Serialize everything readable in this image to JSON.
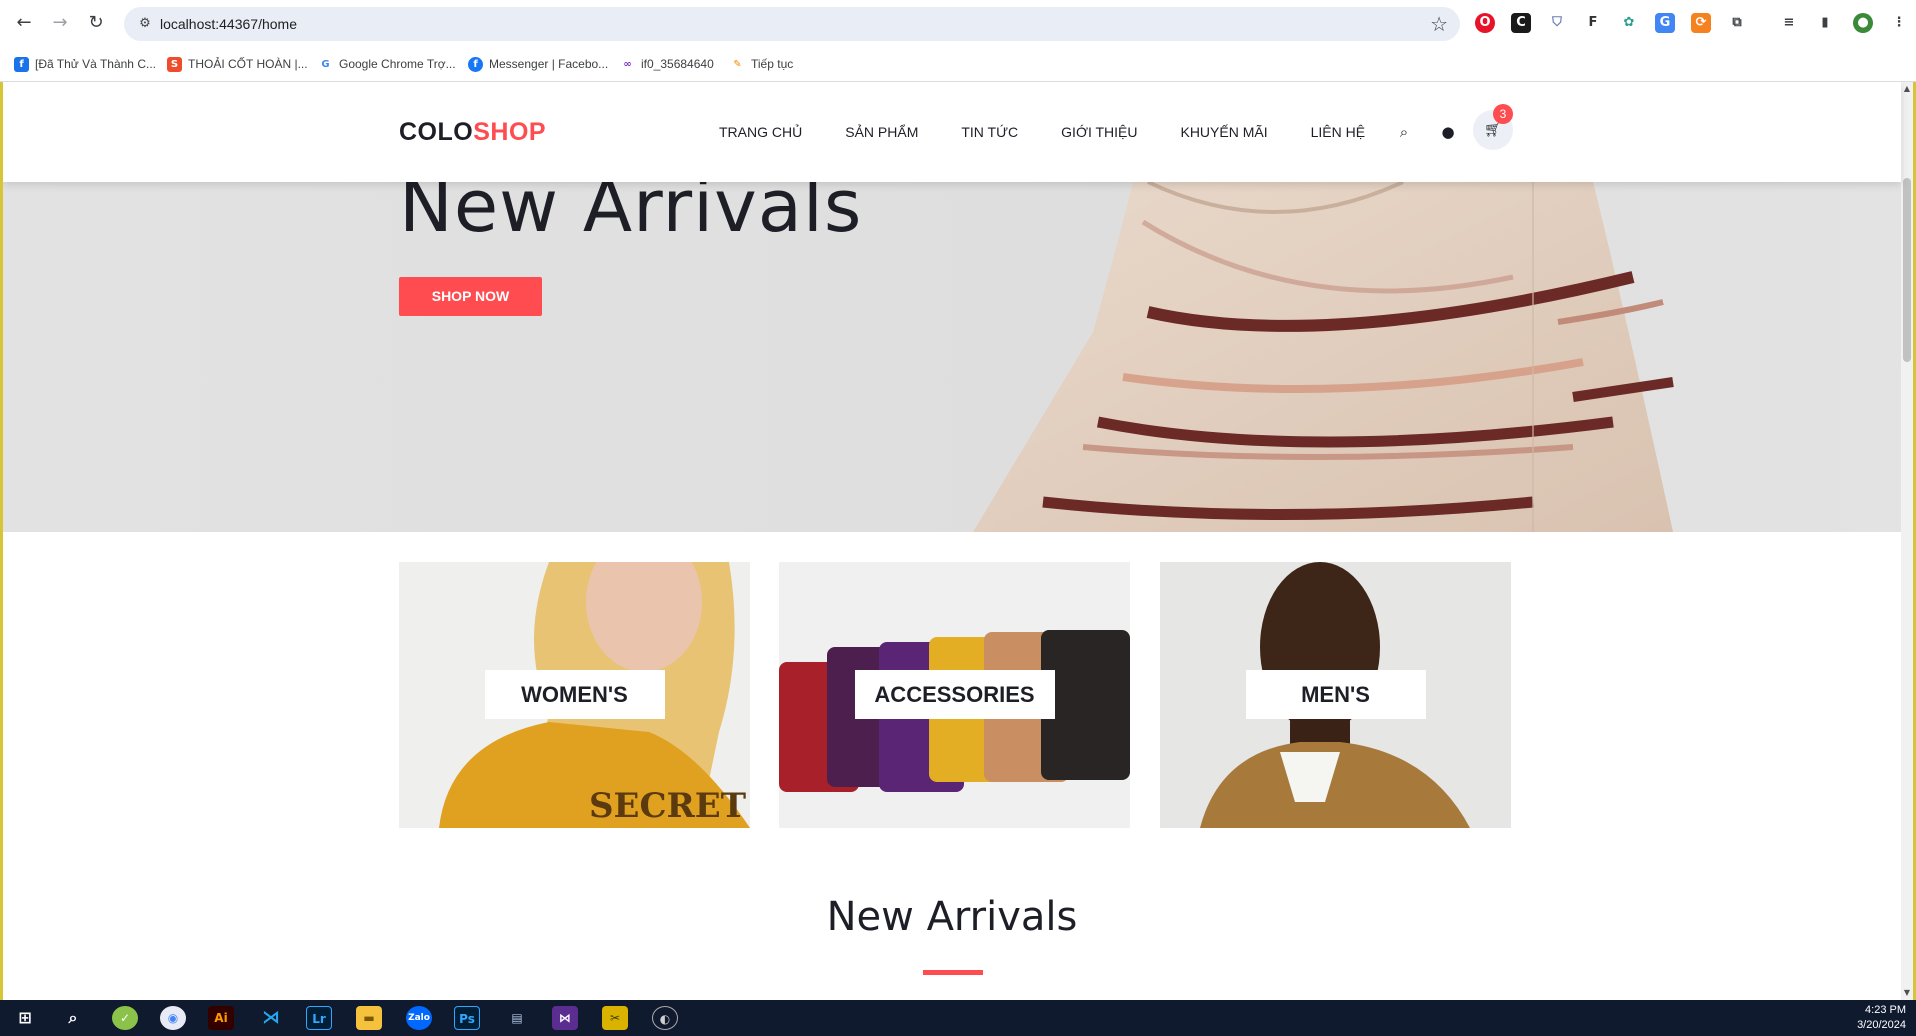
{
  "browser": {
    "url": "localhost:44367/home",
    "bookmarks": [
      {
        "label": "[Đã Thử Và Thành C...",
        "icon": "blue-square-icon",
        "color": "#1a73e8"
      },
      {
        "label": "THOẢI CỐT HOÀN |...",
        "icon": "shopee-icon",
        "color": "#ee4d2d"
      },
      {
        "label": "Google Chrome Trợ...",
        "icon": "google-icon",
        "color": "#4285f4"
      },
      {
        "label": "Messenger | Facebo...",
        "icon": "facebook-icon",
        "color": "#1877f2"
      },
      {
        "label": "if0_35684640",
        "icon": "infinity-icon",
        "color": "#7b2cbf"
      },
      {
        "label": "Tiếp tục",
        "icon": "brush-icon",
        "color": "#f28b00"
      }
    ]
  },
  "site": {
    "logo_colo": "COLO",
    "logo_shop": "SHOP",
    "menu": [
      "TRANG CHỦ",
      "SẢN PHẨM",
      "TIN TỨC",
      "GIỚI THIỆU",
      "KHUYẾN MÃI",
      "LIÊN HỆ"
    ],
    "cart_count": "3",
    "accent": "#fe4c50"
  },
  "hero": {
    "title": "New Arrivals",
    "button": "SHOP NOW"
  },
  "banners": [
    "WOMEN'S",
    "ACCESSORIES",
    "MEN'S"
  ],
  "section": {
    "title": "New Arrivals"
  },
  "taskbar": {
    "time": "4:23 PM",
    "date": "3/20/2024"
  }
}
